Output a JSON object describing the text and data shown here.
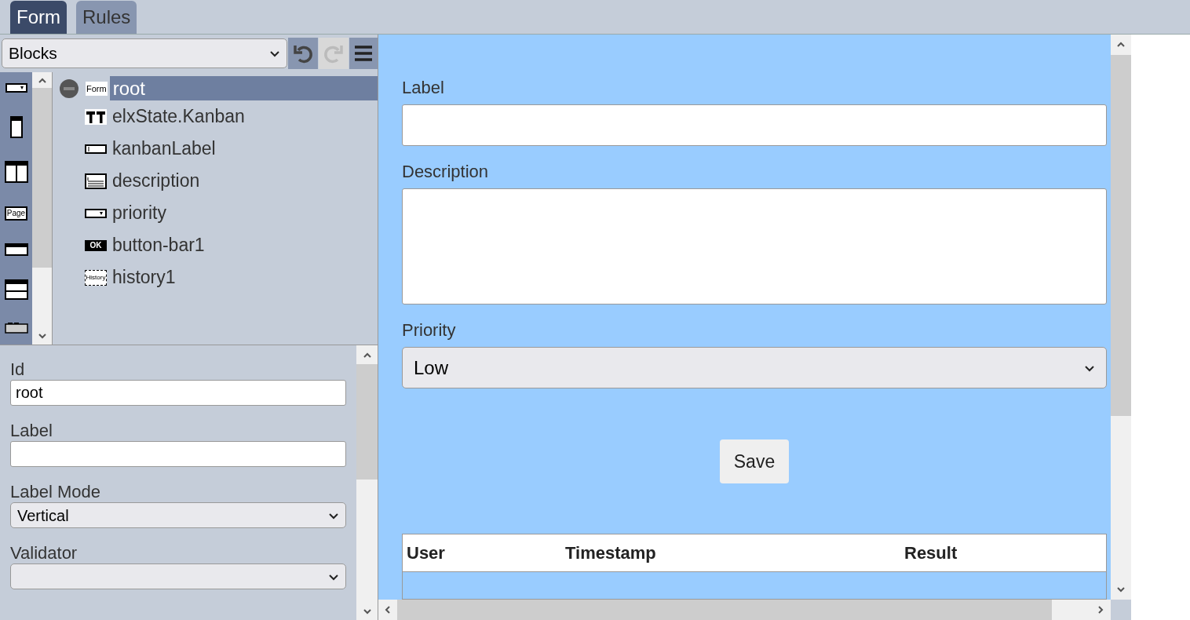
{
  "tabs": [
    {
      "label": "Form",
      "selected": true
    },
    {
      "label": "Rules",
      "selected": false
    }
  ],
  "toolbar": {
    "block_select": "Blocks",
    "undo_disabled": false,
    "redo_disabled": true
  },
  "palette": [
    {
      "kind": "dropdown"
    },
    {
      "kind": "column"
    },
    {
      "kind": "columns"
    },
    {
      "kind": "page",
      "label": "Page"
    },
    {
      "kind": "bar"
    },
    {
      "kind": "rows"
    },
    {
      "kind": "tray"
    }
  ],
  "tree": {
    "label": "root",
    "badge": "Form",
    "selected": true,
    "expanded": true,
    "children": [
      {
        "label": "elxState.Kanban",
        "kind": "title",
        "selected": false
      },
      {
        "label": "kanbanLabel",
        "kind": "textbox",
        "selected": false
      },
      {
        "label": "description",
        "kind": "textarea",
        "selected": false
      },
      {
        "label": "priority",
        "kind": "dropdown",
        "selected": false
      },
      {
        "label": "button-bar1",
        "kind": "buttons",
        "badge": "OK",
        "selected": false
      },
      {
        "label": "history1",
        "kind": "history",
        "badge": "History",
        "selected": false
      }
    ]
  },
  "properties": [
    {
      "kind": "text",
      "label": "Id",
      "value": "root"
    },
    {
      "kind": "text",
      "label": "Label"
    },
    {
      "kind": "select",
      "label": "Label Mode",
      "value": "Vertical"
    },
    {
      "kind": "select",
      "label": "Validator"
    }
  ],
  "preview": {
    "fields": [
      {
        "kind": "text",
        "label": "Label"
      },
      {
        "kind": "textarea",
        "label": "Description"
      },
      {
        "kind": "select",
        "label": "Priority",
        "value": "Low"
      }
    ],
    "button": "Save",
    "history_columns": [
      "User",
      "Timestamp",
      "Result"
    ]
  }
}
